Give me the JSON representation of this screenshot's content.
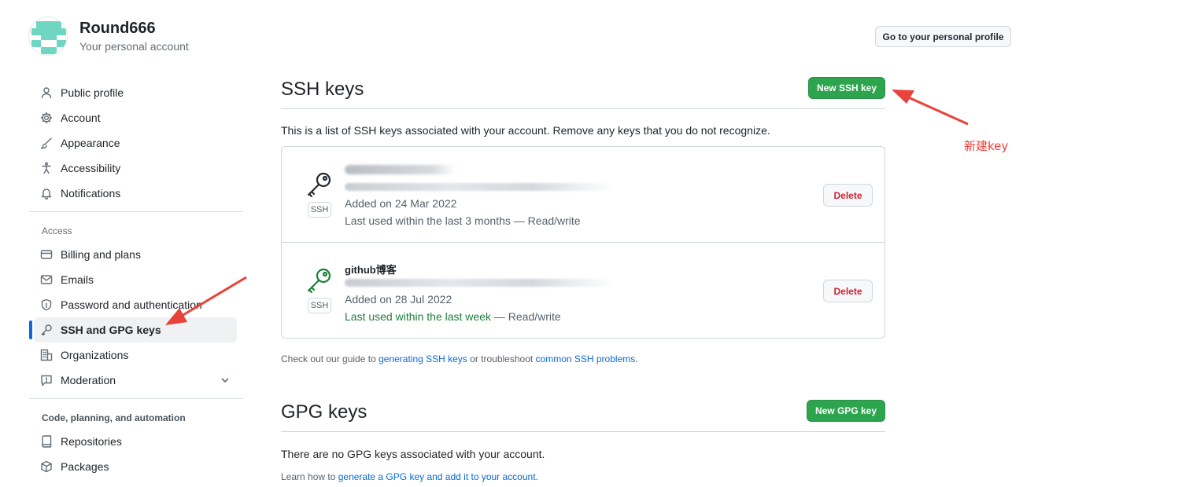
{
  "header": {
    "user_name": "Round666",
    "user_subtitle": "Your personal account",
    "profile_button": "Go to your personal profile",
    "avatar_colors": [
      "#6fd6c4",
      "#ffffff"
    ]
  },
  "sidebar": {
    "items": [
      {
        "label": "Public profile",
        "icon": "person-icon"
      },
      {
        "label": "Account",
        "icon": "gear-icon"
      },
      {
        "label": "Appearance",
        "icon": "paintbrush-icon"
      },
      {
        "label": "Accessibility",
        "icon": "accessibility-icon"
      },
      {
        "label": "Notifications",
        "icon": "bell-icon"
      }
    ],
    "access_heading": "Access",
    "access_items": [
      {
        "label": "Billing and plans",
        "icon": "credit-card-icon"
      },
      {
        "label": "Emails",
        "icon": "mail-icon"
      },
      {
        "label": "Password and authentication",
        "icon": "shield-lock-icon"
      },
      {
        "label": "SSH and GPG keys",
        "icon": "key-icon",
        "active": true
      },
      {
        "label": "Organizations",
        "icon": "organization-icon"
      },
      {
        "label": "Moderation",
        "icon": "report-icon",
        "expandable": true
      }
    ],
    "code_heading": "Code, planning, and automation",
    "code_items": [
      {
        "label": "Repositories",
        "icon": "repo-icon"
      },
      {
        "label": "Packages",
        "icon": "package-icon"
      }
    ]
  },
  "ssh": {
    "title": "SSH keys",
    "new_button": "New SSH key",
    "intro": "This is a list of SSH keys associated with your account. Remove any keys that you do not recognize.",
    "keys": [
      {
        "title": "",
        "badge": "SSH",
        "added": "Added on 24 Mar 2022",
        "last_used": "Last used within the last 3 months — Read/write",
        "delete": "Delete",
        "icon_color": "#24292f"
      },
      {
        "title": "github博客",
        "badge": "SSH",
        "added": "Added on 28 Jul 2022",
        "last_used_green": "Last used within the last week",
        "last_used_rest": " — Read/write",
        "delete": "Delete",
        "icon_color": "#1a7f37"
      }
    ],
    "guide_prefix": "Check out our guide to ",
    "guide_link1": "generating SSH keys",
    "guide_mid": " or troubleshoot ",
    "guide_link2": "common SSH problems",
    "guide_suffix": "."
  },
  "gpg": {
    "title": "GPG keys",
    "new_button": "New GPG key",
    "empty": "There are no GPG keys associated with your account.",
    "learn_prefix": "Learn how to ",
    "learn_link": "generate a GPG key and add it to your account",
    "learn_suffix": "."
  },
  "annotation": {
    "label": "新建key",
    "color": "#e8423a"
  },
  "colors": {
    "green": "#2da44e",
    "link": "#0969da",
    "danger": "#cf222e",
    "active_bar": "#0969da"
  }
}
